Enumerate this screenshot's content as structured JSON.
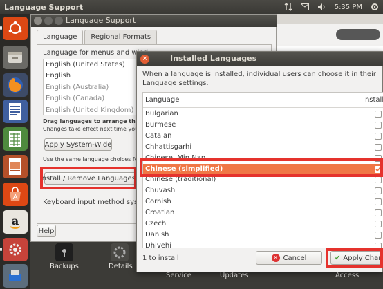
{
  "topbar": {
    "app_title": "Language Support",
    "time": "5:35 PM"
  },
  "language_support": {
    "title": "Language Support",
    "tabs": [
      "Language",
      "Regional Formats"
    ],
    "menus_label": "Language for menus and wind",
    "languages": [
      "English (United States)",
      "English",
      "English (Australia)",
      "English (Canada)",
      "English (United Kingdom)"
    ],
    "drag_hint": "Drag languages to arrange them i",
    "changes_hint": "Changes take effect next time you",
    "apply_system_wide": "Apply System-Wide",
    "same_language_hint": "Use the same language choices for",
    "install_remove": "Install / Remove Languages...",
    "keyboard_label": "Keyboard input method syste",
    "help": "Help"
  },
  "settings_strip": {
    "backups": "Backups",
    "details": "Details",
    "service": "Service",
    "updates": "Updates",
    "access": "Access"
  },
  "installed_languages": {
    "title": "Installed Languages",
    "description": "When a language is installed, individual users can choose it in their Language settings.",
    "col_language": "Language",
    "col_installed": "Installe",
    "rows": [
      {
        "name": "Bulgarian",
        "checked": false
      },
      {
        "name": "Burmese",
        "checked": false
      },
      {
        "name": "Catalan",
        "checked": false
      },
      {
        "name": "Chhattisgarhi",
        "checked": false
      },
      {
        "name": "Chinese, Min Nan",
        "checked": false
      },
      {
        "name": "Chinese (simplified)",
        "checked": true
      },
      {
        "name": "Chinese (traditional)",
        "checked": false
      },
      {
        "name": "Chuvash",
        "checked": false
      },
      {
        "name": "Cornish",
        "checked": false
      },
      {
        "name": "Croatian",
        "checked": false
      },
      {
        "name": "Czech",
        "checked": false
      },
      {
        "name": "Danish",
        "checked": false
      },
      {
        "name": "Dhivehi",
        "checked": false
      }
    ],
    "status": "1 to install",
    "cancel": "Cancel",
    "apply": "Apply Chang"
  },
  "colors": {
    "accent": "#f07746",
    "highlight_box": "#e5322d",
    "launcher": "#2b2a27"
  }
}
